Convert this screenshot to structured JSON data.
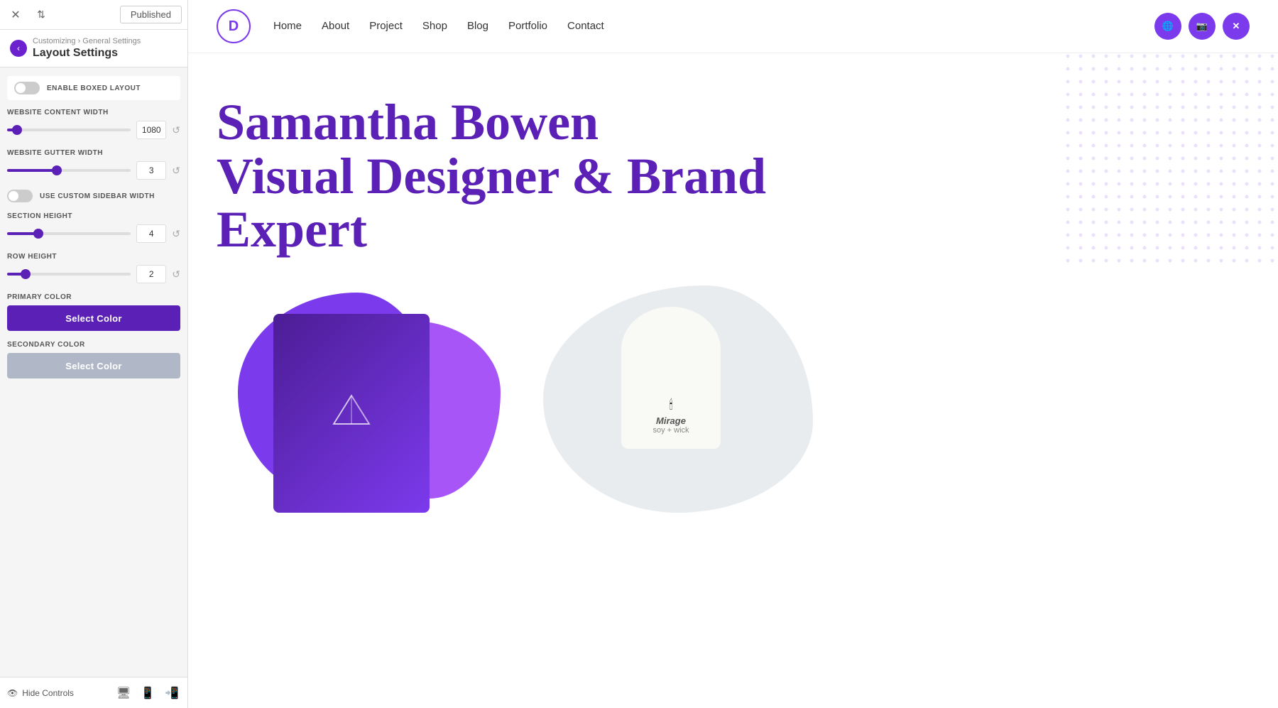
{
  "topbar": {
    "close_icon": "✕",
    "sort_icon": "⇅",
    "published_label": "Published"
  },
  "panel": {
    "back_icon": "‹",
    "breadcrumb": "Customizing › General Settings",
    "title": "Layout Settings",
    "enable_boxed_layout_label": "ENABLE BOXED LAYOUT",
    "website_content_width_label": "WEBSITE CONTENT WIDTH",
    "website_content_width_value": "1080",
    "website_gutter_width_label": "WEBSITE GUTTER WIDTH",
    "website_gutter_width_value": "3",
    "use_custom_sidebar_label": "USE CUSTOM SIDEBAR WIDTH",
    "section_height_label": "SECTION HEIGHT",
    "section_height_value": "4",
    "row_height_label": "ROW HEIGHT",
    "row_height_value": "2",
    "primary_color_label": "PRIMARY COLOR",
    "primary_color_btn": "Select Color",
    "secondary_color_label": "SECONDARY COLOR",
    "secondary_color_btn": "Select Color",
    "reset_icon": "↺",
    "hide_controls_label": "Hide Controls"
  },
  "nav": {
    "logo_letter": "D",
    "links": [
      "Home",
      "About",
      "Project",
      "Shop",
      "Blog",
      "Portfolio",
      "Contact"
    ],
    "social_icons": [
      "🌐",
      "📷",
      "✕"
    ]
  },
  "hero": {
    "line1": "Samantha Bowen",
    "line2": "Visual Designer & Brand",
    "line3": "Expert"
  },
  "candle": {
    "brand": "Mirage",
    "subtitle": "soy + wick"
  },
  "colors": {
    "primary": "#5b21b6",
    "secondary": "#b0b8c8",
    "accent": "#7c3aed"
  },
  "sliders": {
    "content_width_percent": 8,
    "gutter_width_percent": 40,
    "section_height_percent": 25,
    "row_height_percent": 15
  }
}
